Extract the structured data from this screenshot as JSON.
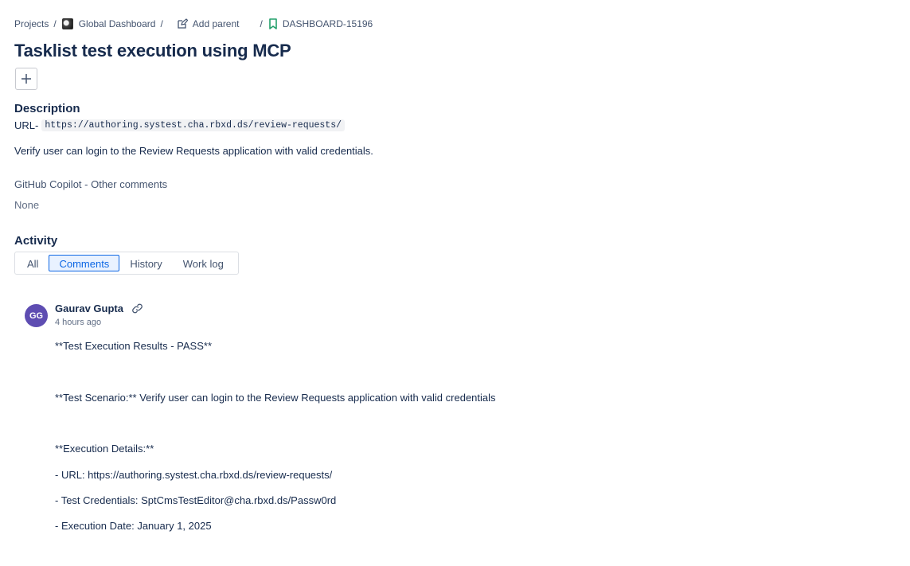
{
  "breadcrumb": {
    "projects": "Projects",
    "project_name": "Global Dashboard",
    "add_parent": "Add parent",
    "issue_key": "DASHBOARD-15196",
    "separator": "/"
  },
  "issue": {
    "title": "Tasklist test execution using MCP"
  },
  "description": {
    "heading": "Description",
    "url_prefix": "URL-",
    "url_code": "https://authoring.systest.cha.rbxd.ds/review-requests/",
    "text": "Verify user can login to the Review Requests application with valid credentials."
  },
  "fields": {
    "copilot_label": "GitHub Copilot - Other comments",
    "copilot_value": "None"
  },
  "activity": {
    "heading": "Activity",
    "tabs": [
      "All",
      "Comments",
      "History",
      "Work log"
    ],
    "active_tab": "Comments"
  },
  "comment": {
    "avatar_initials": "GG",
    "avatar_color": "#5e4db2",
    "author": "Gaurav Gupta",
    "time": "4 hours ago",
    "lines": [
      "**Test Execution Results - PASS**",
      "**Test Scenario:** Verify user can login to the Review Requests application with valid credentials",
      "**Execution Details:**",
      "- URL: https://authoring.systest.cha.rbxd.ds/review-requests/",
      "- Test Credentials: SptCmsTestEditor@cha.rbxd.ds/Passw0rd",
      "- Execution Date: January 1, 2025"
    ]
  },
  "colors": {
    "text_primary": "#172b4d",
    "text_subtle": "#44546f",
    "accent": "#0c66e4",
    "issue_icon": "#22a06b"
  }
}
